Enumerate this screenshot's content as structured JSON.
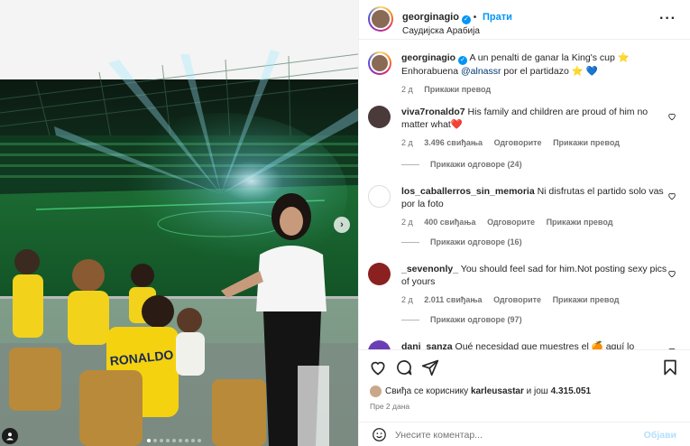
{
  "post": {
    "username": "georginagio",
    "follow_label": "Прати",
    "location": "Саудијска Арабија",
    "more_icon": "more-horizontal-icon"
  },
  "caption": {
    "username": "georginagio",
    "text_1": "A un penalti de ganar la King's cup ⭐",
    "text_2": "Enhorabuena",
    "mention": "@alnassr",
    "text_3": "por el partidazo ⭐ 💙",
    "time": "2 д",
    "translate": "Прикажи превод"
  },
  "comments": [
    {
      "username": "viva7ronaldo7",
      "text": "His family and children are proud of him no matter what❤️",
      "time": "2 д",
      "likes": "3.496 свиђања",
      "reply": "Одговорите",
      "translate": "Прикажи превод",
      "replies": "Прикажи одговоре (24)"
    },
    {
      "username": "los_caballerros_sin_memoria",
      "text": "Ni disfrutas el partido solo vas por la foto",
      "time": "2 д",
      "likes": "400 свиђања",
      "reply": "Одговорите",
      "translate": "Прикажи превод",
      "replies": "Прикажи одговоре (16)"
    },
    {
      "username": "_sevenonly_",
      "text": "You should feel sad for him.Not posting sexy pics of yours",
      "time": "2 д",
      "likes": "2.011 свиђања",
      "reply": "Одговорите",
      "translate": "Прикажи превод",
      "replies": "Прикажи одговоре (97)"
    },
    {
      "username": "dani_sanza",
      "text": "Qué necesidad que muestres el 🍊 aquí lo"
    }
  ],
  "actions": {
    "liked_by_prefix": "Свиђа се кориснику",
    "liked_by_user": "karleusastar",
    "liked_by_mid": "и још",
    "liked_by_count": "4.315.051",
    "posted_ago": "Пре 2 дана"
  },
  "composer": {
    "placeholder": "Унесите коментар...",
    "post_label": "Објави"
  },
  "media": {
    "jersey_text": "RONALDO",
    "carousel_dots": 9,
    "active_dot": 1
  },
  "colors": {
    "accent": "#0095f6",
    "post_disabled": "#b2dffc",
    "heart_red": "#ed4956"
  }
}
